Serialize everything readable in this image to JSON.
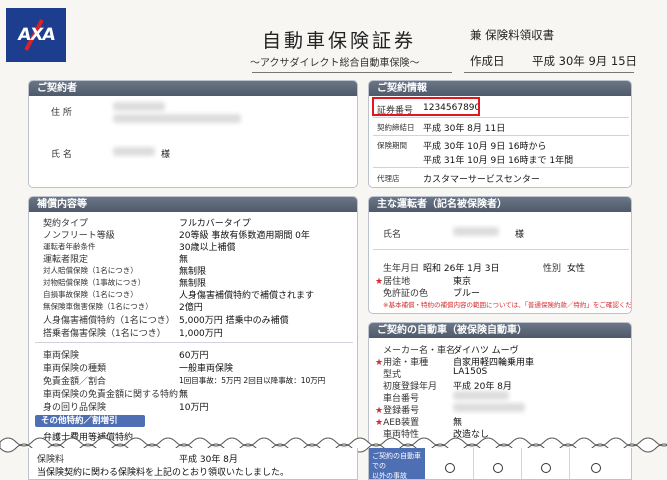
{
  "header": {
    "logo": "AXA",
    "title": "自動車保険証券",
    "subtitle": "〜アクサダイレクト総合自動車保険〜",
    "receipt_label": "兼 保険料領収書",
    "issue_label": "作成日",
    "issue_date": "平成 30年 9月 15日"
  },
  "contractor": {
    "heading": "ご契約者",
    "address_label": "住 所",
    "name_label": "氏 名",
    "honorific": "様"
  },
  "contract_info": {
    "heading": "ご契約情報",
    "policy_no_label": "証券番号",
    "policy_no": "1234567890",
    "sign_date_label": "契約締結日",
    "sign_date": "平成 30年 8月 11日",
    "period_label": "保険期間",
    "period_from": "平成 30年 10月 9日 16時から",
    "period_to": "平成 31年 10月 9日 16時まで 1年間",
    "agent_label": "代理店",
    "agent": "カスタマーサービスセンター"
  },
  "coverage": {
    "heading": "補償内容等",
    "rows": [
      {
        "label": "契約タイプ",
        "value": "フルカバータイプ"
      },
      {
        "label": "ノンフリート等級",
        "value": "20等級  事故有係数適用期間 0年"
      },
      {
        "label": "運転者年齢条件",
        "value": "30歳以上補償"
      },
      {
        "label": "運転者限定",
        "value": "無"
      },
      {
        "label": "対人賠償保険（1名につき）",
        "value": "無制限"
      },
      {
        "label": "対物賠償保険（1事故につき）",
        "value": "無制限"
      },
      {
        "label": "自損事故保険（1名につき）",
        "value": "人身傷害補償特約で補償されます"
      },
      {
        "label": "無保険車傷害保険（1名につき）",
        "value": "2億円"
      },
      {
        "label": "人身傷害補償特約（1名につき）",
        "value": "5,000万円  搭乗中のみ補償"
      },
      {
        "label": "搭乗者傷害保険（1名につき）",
        "value": "1,000万円"
      }
    ],
    "rows2": [
      {
        "label": "車両保険",
        "value": "60万円"
      },
      {
        "label": "車両保険の種類",
        "value": "一般車両保険"
      },
      {
        "label": "免責金額／割合",
        "value": "1回目事故：5万円  2回目以降事故：10万円"
      },
      {
        "label": "車両保険の免責金額に関する特約",
        "value": "無"
      },
      {
        "label": "身の回り品保険",
        "value": "10万円"
      }
    ],
    "special_heading": "その他特約／割増引",
    "special_row": "弁護士費用等補償特約",
    "bottom_row_label": "保険料",
    "bottom_row_value": "平成 30年 8月",
    "bottom_note": "当保険契約に関わる保険料を上記のとおり領収いたしました。"
  },
  "driver": {
    "heading": "主な運転者（記名被保険者）",
    "name_label": "氏名",
    "honorific": "様",
    "dob_label": "生年月日",
    "dob": "昭和 26年 1月 3日",
    "gender_label": "性別",
    "gender": "女性",
    "residence_label": "居住地",
    "residence": "東京",
    "license_label": "免許証の色",
    "license": "ブルー",
    "note": "※基本補償・特約の補償内容の範囲については、「普通保険約款／特約」をご確認ください。"
  },
  "vehicle": {
    "heading": "ご契約の自動車（被保険自動車）",
    "rows": [
      {
        "label": "メーカー名・車名",
        "value": "ダイハツ ムーヴ",
        "star": false
      },
      {
        "label": "用途・車種",
        "value": "自家用軽四輪乗用車",
        "star": true
      },
      {
        "label": "型式",
        "value": "LA150S",
        "star": false
      },
      {
        "label": "初度登録年月",
        "value": "平成 20年 8月",
        "star": false
      },
      {
        "label": "車台番号",
        "value": "",
        "star": false
      },
      {
        "label": "登録番号",
        "value": "",
        "star": true
      },
      {
        "label": "AEB装置",
        "value": "無",
        "star": true
      },
      {
        "label": "車両特性",
        "value": "改造なし",
        "star": false
      }
    ],
    "accident_label": "ご契約の自動車での\n以外の事故"
  }
}
